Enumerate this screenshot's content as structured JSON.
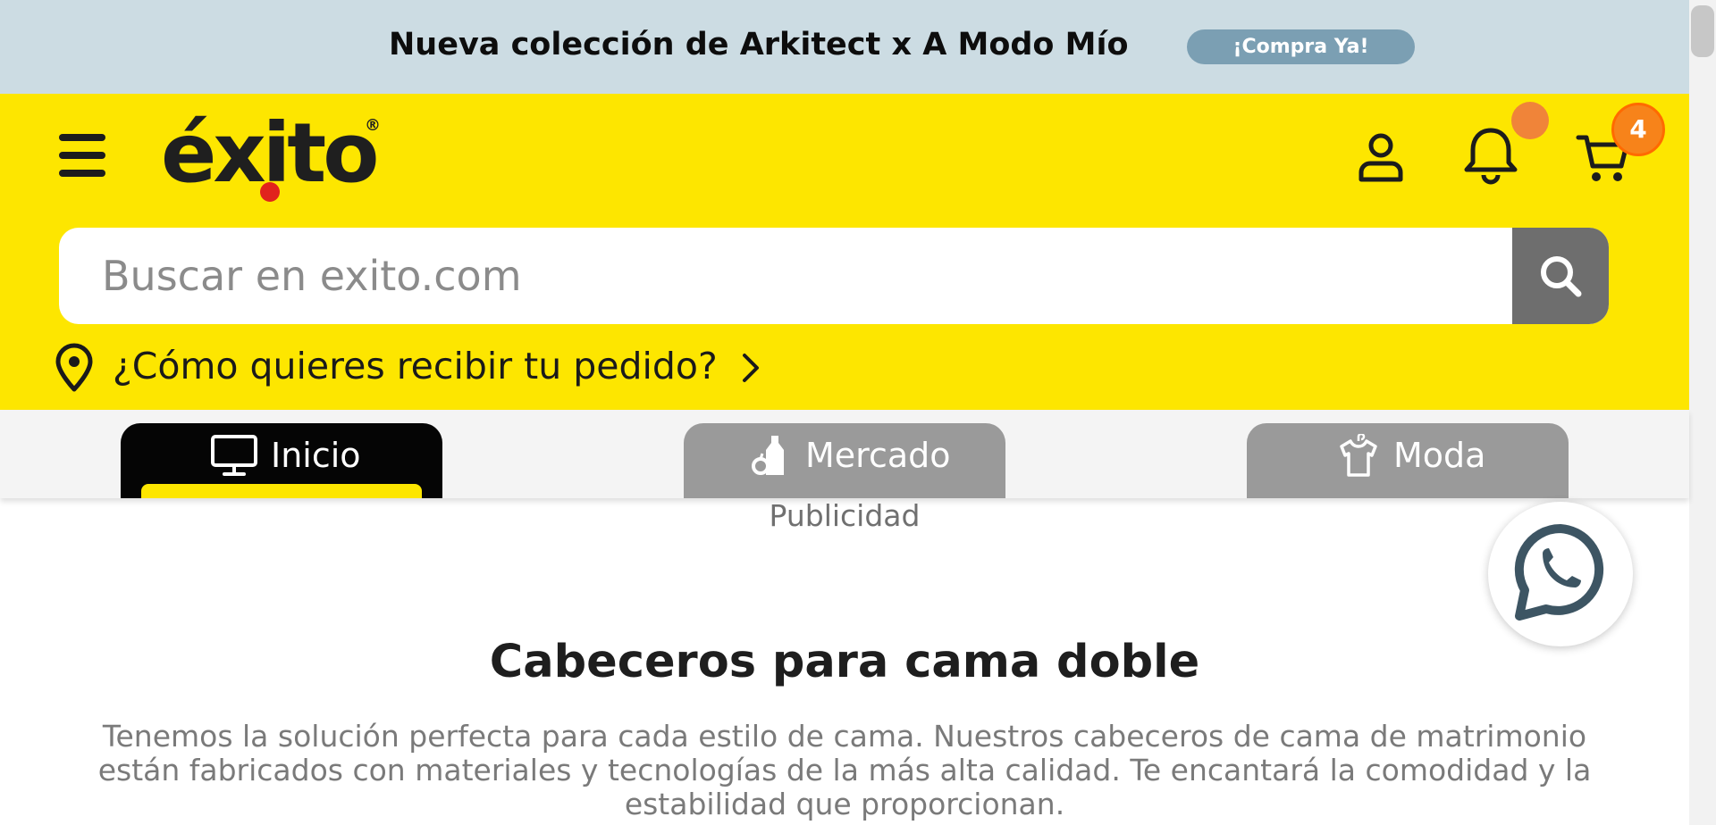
{
  "promo_banner": {
    "text": "Nueva colección de Arkitect x A Modo Mío",
    "button_label": "¡Compra Ya!"
  },
  "header": {
    "logo_text": "éxito",
    "logo_registered": "®",
    "cart_count": "4",
    "search": {
      "placeholder": "Buscar en exito.com",
      "value": ""
    },
    "delivery_prompt": "¿Cómo quieres recibir tu pedido?"
  },
  "tabs": [
    {
      "label": "Inicio",
      "icon": "monitor-icon",
      "active": true
    },
    {
      "label": "Mercado",
      "icon": "bottle-icon",
      "active": false
    },
    {
      "label": "Moda",
      "icon": "shirt-icon",
      "active": false
    }
  ],
  "content": {
    "ad_label": "Publicidad",
    "title": "Cabeceros para cama doble",
    "description": "Tenemos la solución perfecta para cada estilo de cama. Nuestros cabeceros de cama de matrimonio están fabricados con materiales y tecnologías de la más alta calidad. Te encantará la comodidad y la estabilidad que proporcionan."
  },
  "colors": {
    "promo_bg": "#ccdce3",
    "promo_button": "#7b9fb3",
    "brand_yellow": "#fde600",
    "notification_orange": "#f7831a",
    "active_tab": "#050505",
    "inactive_tab": "#9a9a9a"
  }
}
